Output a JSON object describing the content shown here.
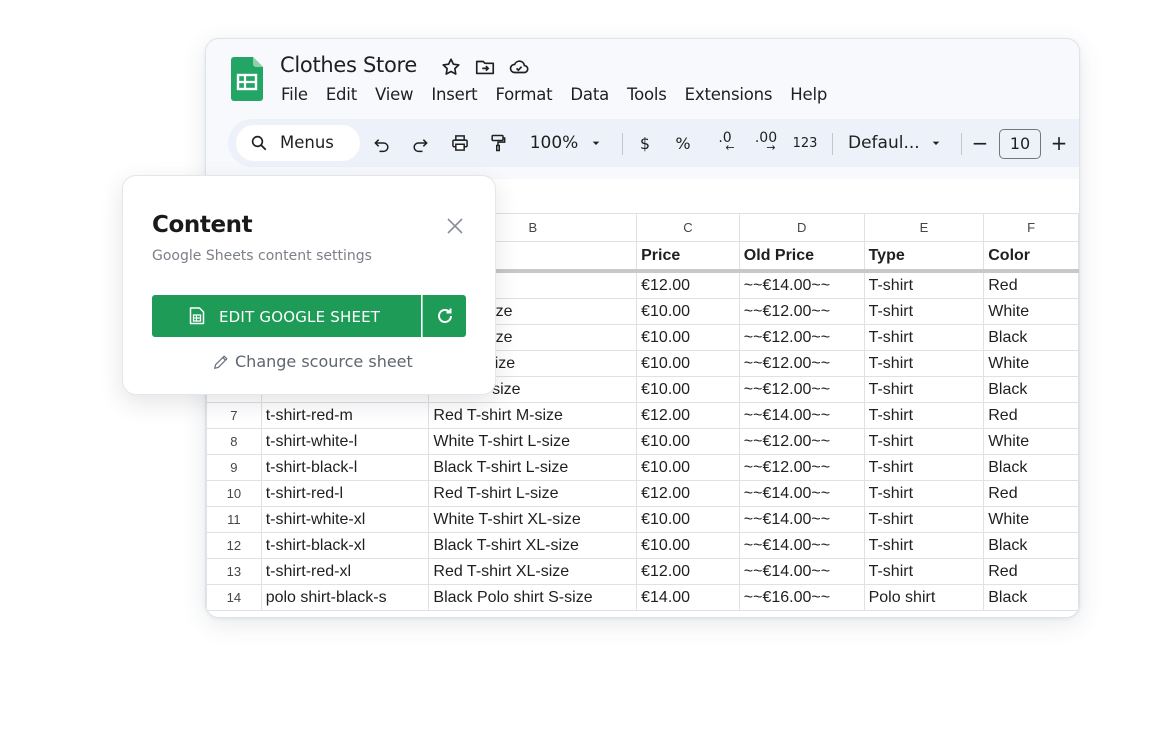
{
  "sheet": {
    "title": "Clothes Store",
    "menu": [
      "File",
      "Edit",
      "View",
      "Insert",
      "Format",
      "Data",
      "Tools",
      "Extensions",
      "Help"
    ],
    "toolbar": {
      "search_label": "Menus",
      "zoom": "100%",
      "currency": "$",
      "percent": "%",
      "dec_less": ".0",
      "dec_more": ".00",
      "number_format": "123",
      "font_name": "Defaul...",
      "minus": "−",
      "font_size": "10",
      "plus": "+"
    },
    "columns": [
      "B",
      "C",
      "D",
      "E",
      "F"
    ],
    "col_a_label": "",
    "header": {
      "a": "",
      "b": "",
      "c": "Price",
      "d": "Old Price",
      "e": "Type",
      "f": "Color"
    },
    "rows": [
      {
        "n": "",
        "a": "",
        "b": "irt S-size",
        "c": "€12.00",
        "d": "~~€14.00~~",
        "e": "T-shirt",
        "f": "Red"
      },
      {
        "n": "",
        "a": "",
        "b": "shirt S-size",
        "c": "€10.00",
        "d": "~~€12.00~~",
        "e": "T-shirt",
        "f": "White"
      },
      {
        "n": "",
        "a": "",
        "b": "shirt S-size",
        "c": "€10.00",
        "d": "~~€12.00~~",
        "e": "T-shirt",
        "f": "Black"
      },
      {
        "n": "",
        "a": "",
        "b": "shirt M-size",
        "c": "€10.00",
        "d": "~~€12.00~~",
        "e": "T-shirt",
        "f": "White"
      },
      {
        "n": "",
        "a": "",
        "b": "-shirt M-size",
        "c": "€10.00",
        "d": "~~€12.00~~",
        "e": "T-shirt",
        "f": "Black"
      },
      {
        "n": "7",
        "a": "t-shirt-red-m",
        "b": "Red T-shirt M-size",
        "c": "€12.00",
        "d": "~~€14.00~~",
        "e": "T-shirt",
        "f": "Red"
      },
      {
        "n": "8",
        "a": "t-shirt-white-l",
        "b": "White T-shirt L-size",
        "c": "€10.00",
        "d": "~~€12.00~~",
        "e": "T-shirt",
        "f": "White"
      },
      {
        "n": "9",
        "a": "t-shirt-black-l",
        "b": "Black T-shirt L-size",
        "c": "€10.00",
        "d": "~~€12.00~~",
        "e": "T-shirt",
        "f": "Black"
      },
      {
        "n": "10",
        "a": "t-shirt-red-l",
        "b": "Red T-shirt L-size",
        "c": "€12.00",
        "d": "~~€14.00~~",
        "e": "T-shirt",
        "f": "Red"
      },
      {
        "n": "11",
        "a": "t-shirt-white-xl",
        "b": "White T-shirt XL-size",
        "c": "€10.00",
        "d": "~~€14.00~~",
        "e": "T-shirt",
        "f": "White"
      },
      {
        "n": "12",
        "a": "t-shirt-black-xl",
        "b": "Black T-shirt XL-size",
        "c": "€10.00",
        "d": "~~€14.00~~",
        "e": "T-shirt",
        "f": "Black"
      },
      {
        "n": "13",
        "a": "t-shirt-red-xl",
        "b": "Red T-shirt XL-size",
        "c": "€12.00",
        "d": "~~€14.00~~",
        "e": "T-shirt",
        "f": "Red"
      },
      {
        "n": "14",
        "a": "polo shirt-black-s",
        "b": "Black Polo shirt S-size",
        "c": "€14.00",
        "d": "~~€16.00~~",
        "e": "Polo shirt",
        "f": "Black"
      }
    ]
  },
  "card": {
    "title": "Content",
    "subtitle": "Google Sheets content settings",
    "edit_button": "EDIT GOOGLE SHEET",
    "change_link": "Change scource sheet"
  },
  "colors": {
    "accent_green": "#1d9b57",
    "sheets_green": "#23a566"
  },
  "icons": [
    "search-icon",
    "star-icon",
    "move-folder-icon",
    "cloud-icon",
    "undo-icon",
    "redo-icon",
    "print-icon",
    "paint-format-icon",
    "chevron-down-icon",
    "sheet-file-icon",
    "refresh-icon",
    "close-icon",
    "pencil-icon"
  ]
}
